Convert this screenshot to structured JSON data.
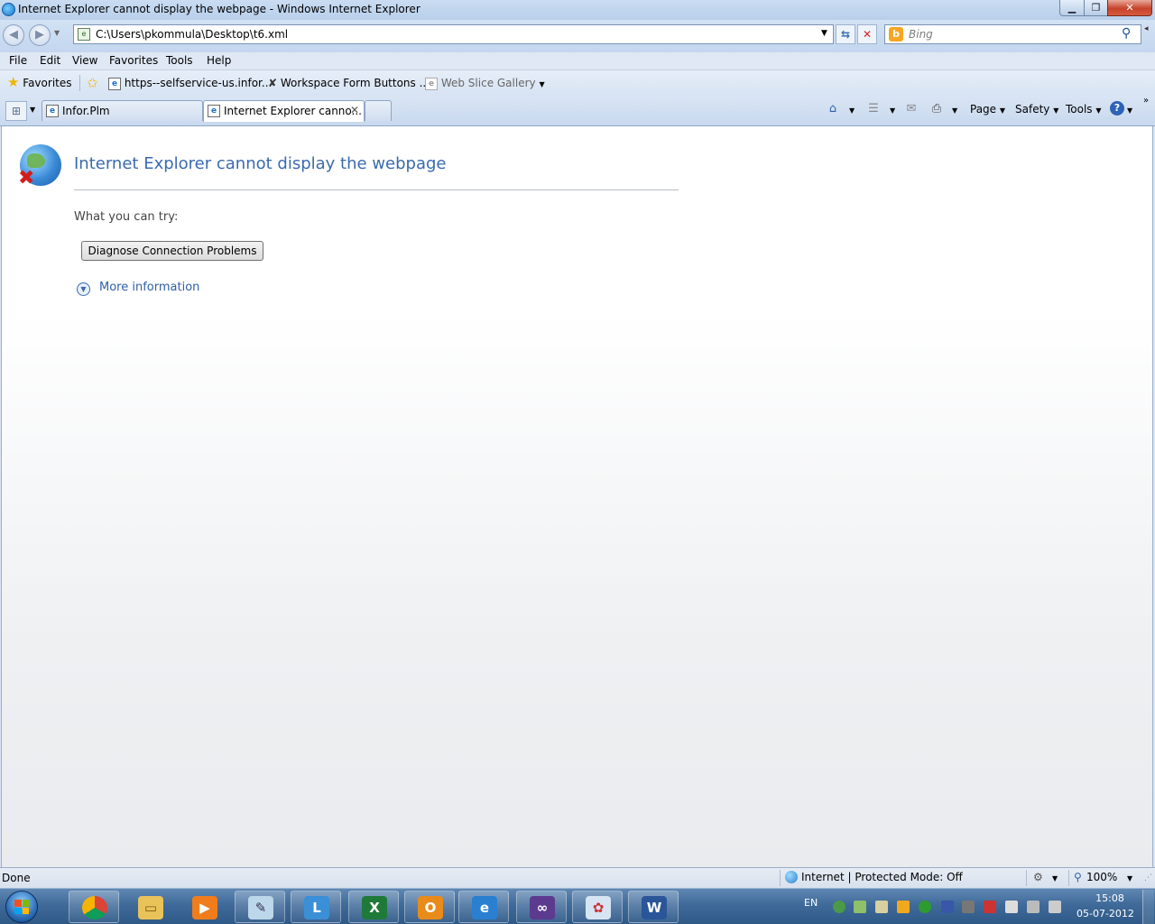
{
  "window": {
    "title": "Internet Explorer cannot display the webpage - Windows Internet Explorer",
    "minimize_icon": "minimize-icon",
    "maximize_icon": "restore-icon",
    "close_icon": "close-icon"
  },
  "address": {
    "url": "C:\\Users\\pkommula\\Desktop\\t6.xml"
  },
  "search": {
    "placeholder": "Bing"
  },
  "menu": [
    "File",
    "Edit",
    "View",
    "Favorites",
    "Tools",
    "Help"
  ],
  "favorites": {
    "label": "Favorites",
    "items": [
      "https--selfservice-us.infor...",
      "Workspace Form Buttons ...",
      "Web Slice Gallery"
    ]
  },
  "tabs": [
    {
      "label": "Infor.Plm",
      "active": false
    },
    {
      "label": "Internet Explorer canno...",
      "active": true
    }
  ],
  "commandbar": {
    "page": "Page",
    "safety": "Safety",
    "tools": "Tools"
  },
  "content": {
    "heading": "Internet Explorer cannot display the webpage",
    "try_label": "What you can try:",
    "diagnose_button": "Diagnose Connection Problems",
    "more_info": "More information"
  },
  "status": {
    "text": "Done",
    "zone": "Internet | Protected Mode: Off",
    "zoom": "100%"
  },
  "taskbar": {
    "apps": [
      "chrome",
      "explorer",
      "media-player",
      "notepad",
      "lync",
      "excel",
      "outlook",
      "internet-explorer",
      "visual-studio",
      "paint",
      "word"
    ],
    "tray_lang": "EN",
    "time": "15:08",
    "date": "05-07-2012"
  },
  "colors": {
    "link": "#2e5fa8",
    "heading": "#3a6aad",
    "taskbar": "#3f6a99"
  }
}
